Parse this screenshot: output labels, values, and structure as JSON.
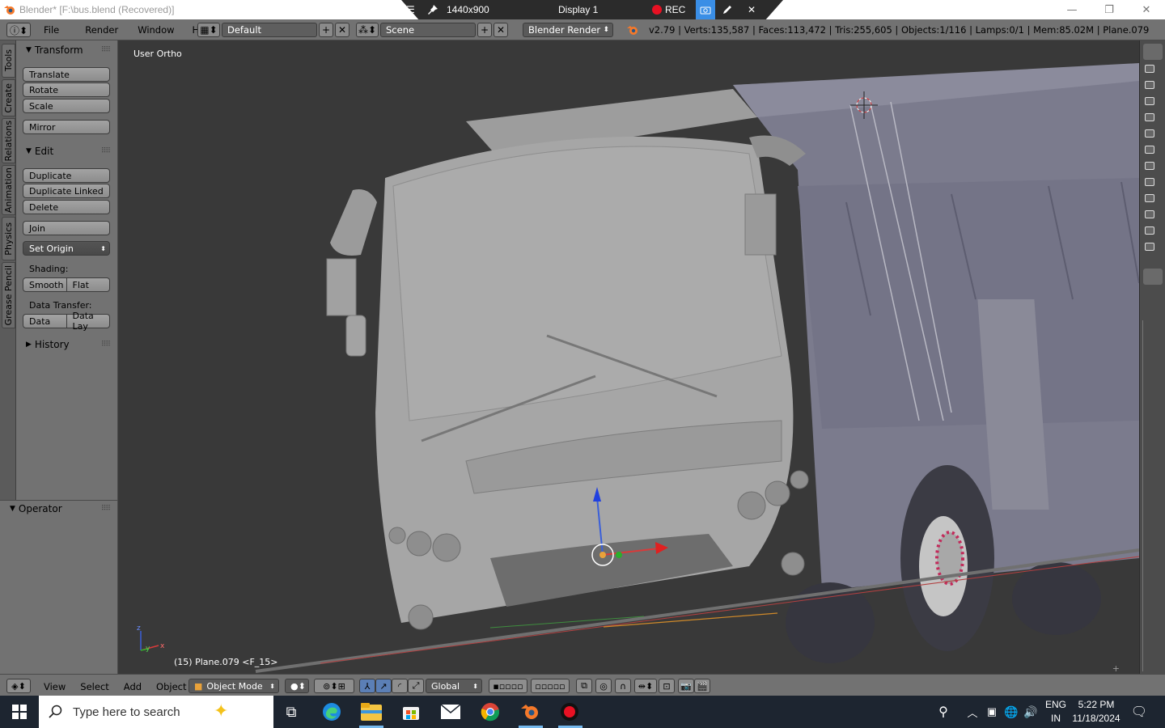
{
  "window": {
    "title": "Blender* [F:\\bus.blend (Recovered)]",
    "minimize_glyph": "—",
    "restore_glyph": "❐",
    "close_glyph": "✕"
  },
  "recorder": {
    "menu_glyph": "☰",
    "pin_glyph": "📌",
    "resolution": "1440x900",
    "display": "Display 1",
    "rec_label": "REC",
    "close_glyph": "✕",
    "accent": "#3a8ee6",
    "rec_color": "#e81123"
  },
  "info_header": {
    "menus": [
      "File",
      "Render",
      "Window",
      "Help"
    ],
    "screen_layout": "Default",
    "scene": "Scene",
    "render_engine": "Blender Render",
    "stats": "v2.79 | Verts:135,587 | Faces:113,472 | Tris:255,605 | Objects:1/116 | Lamps:0/1 | Mem:85.02M | Plane.079"
  },
  "left_tabs": [
    "Tools",
    "Create",
    "Relations",
    "Animation",
    "Physics",
    "Grease Pencil"
  ],
  "toolshelf": {
    "transform_header": "Transform",
    "translate": "Translate",
    "rotate": "Rotate",
    "scale": "Scale",
    "mirror": "Mirror",
    "edit_header": "Edit",
    "duplicate": "Duplicate",
    "duplicate_linked": "Duplicate Linked",
    "delete": "Delete",
    "join": "Join",
    "set_origin": "Set Origin",
    "shading_label": "Shading:",
    "smooth": "Smooth",
    "flat": "Flat",
    "data_transfer_label": "Data Transfer:",
    "data": "Data",
    "data_lay": "Data Lay",
    "history_header": "History"
  },
  "operator": {
    "header": "Operator"
  },
  "viewport": {
    "view_name": "User Ortho",
    "object_info": "(15) Plane.079 <F_15>",
    "axis_x": "x",
    "axis_y": "y",
    "axis_z": "z"
  },
  "view_header": {
    "menus": [
      "View",
      "Select",
      "Add",
      "Object"
    ],
    "mode": "Object Mode",
    "orientation": "Global"
  },
  "taskbar": {
    "search_placeholder": "Type here to search",
    "language": "ENG",
    "region": "IN",
    "time": "5:22 PM",
    "date": "11/18/2024"
  }
}
